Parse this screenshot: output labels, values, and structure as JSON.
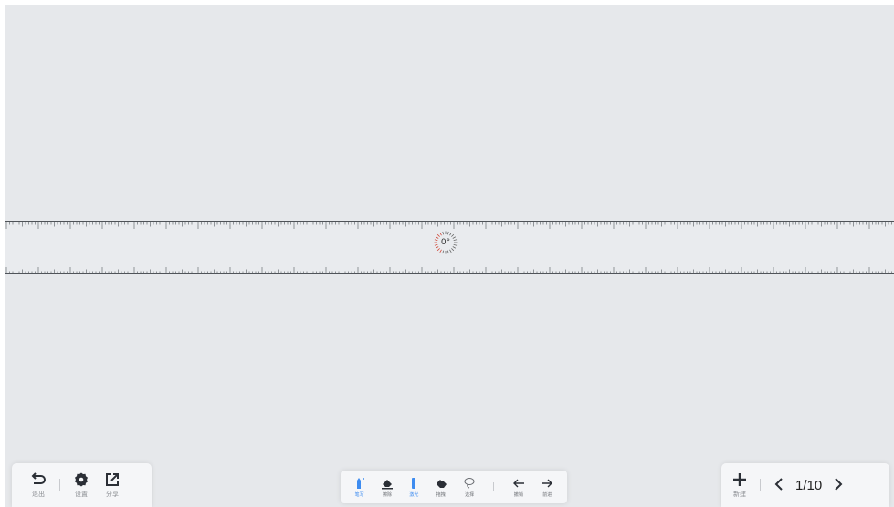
{
  "toolbar_left": {
    "exit_label": "退出",
    "settings_label": "设置",
    "share_label": "分享"
  },
  "toolbar_center": {
    "pen_label": "笔写",
    "eraser_label": "擦除",
    "pointer_label": "激光",
    "drag_label": "拖拽",
    "select_label": "选择",
    "undo_label": "撤销",
    "redo_label": "前进"
  },
  "toolbar_right": {
    "new_label": "新建",
    "page_indicator": "1/10"
  },
  "ruler": {
    "angle": "0°"
  },
  "colors": {
    "canvas": "#e6e8eb",
    "accent": "#3e8cf0",
    "icon": "#2b2f36"
  },
  "icons": [
    "undo-icon",
    "gear-icon",
    "share-icon",
    "pen-icon",
    "eraser-icon",
    "laser-icon",
    "hand-icon",
    "lasso-icon",
    "arrow-left-icon",
    "arrow-right-icon",
    "plus-icon",
    "chevron-left-icon",
    "chevron-right-icon"
  ]
}
